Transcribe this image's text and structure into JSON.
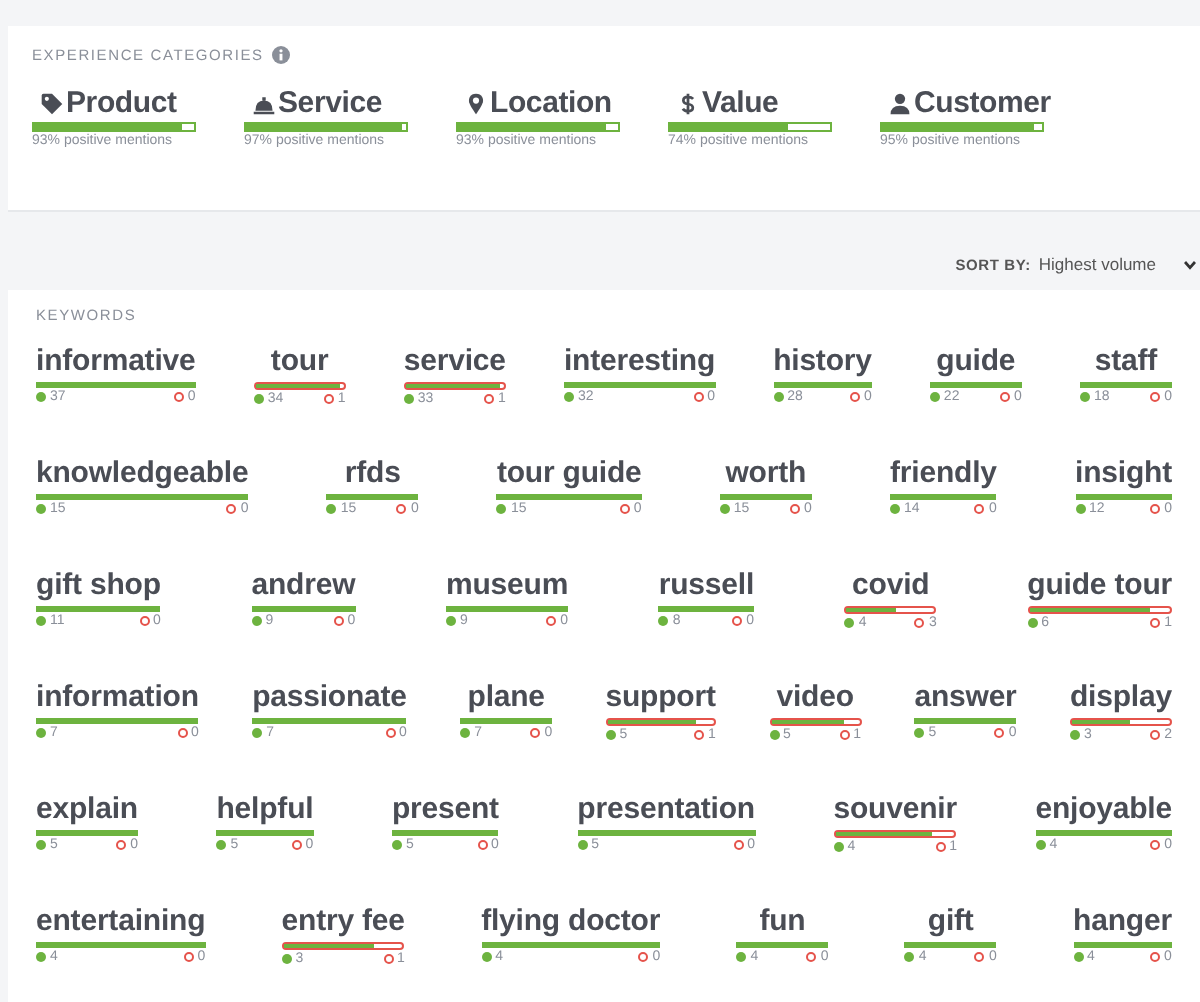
{
  "categories_panel": {
    "title": "EXPERIENCE CATEGORIES",
    "categories": [
      {
        "kind": "tag",
        "label": "Product",
        "level": 0.93,
        "caption": "93% positive mentions"
      },
      {
        "kind": "bell",
        "label": "Service",
        "level": 0.97,
        "caption": "97% positive mentions"
      },
      {
        "kind": "pin",
        "label": "Location",
        "level": 0.93,
        "caption": "93% positive mentions"
      },
      {
        "kind": "dollar",
        "label": "Value",
        "level": 0.74,
        "caption": "74% positive mentions"
      },
      {
        "kind": "person",
        "label": "Customer",
        "level": 0.95,
        "caption": "95% positive mentions"
      }
    ]
  },
  "sort": {
    "label": "SORT BY:",
    "value": "Highest volume"
  },
  "keywords": {
    "title": "KEYWORDS",
    "rows": [
      [
        {
          "word": "informative",
          "positive": "37",
          "negative": "0",
          "level": 1
        },
        {
          "word": "tour",
          "positive": "34",
          "negative": "1",
          "level": 0.97
        },
        {
          "word": "service",
          "positive": "33",
          "negative": "1",
          "level": 0.97
        },
        {
          "word": "interesting",
          "positive": "32",
          "negative": "0",
          "level": 1
        },
        {
          "word": "history",
          "positive": "28",
          "negative": "0",
          "level": 1
        },
        {
          "word": "guide",
          "positive": "22",
          "negative": "0",
          "level": 1
        },
        {
          "word": "staff",
          "positive": "18",
          "negative": "0",
          "level": 1
        }
      ],
      [
        {
          "word": "knowledgeable",
          "positive": "15",
          "negative": "0",
          "level": 1
        },
        {
          "word": "rfds",
          "positive": "15",
          "negative": "0",
          "level": 1
        },
        {
          "word": "tour guide",
          "positive": "15",
          "negative": "0",
          "level": 1
        },
        {
          "word": "worth",
          "positive": "15",
          "negative": "0",
          "level": 1
        },
        {
          "word": "friendly",
          "positive": "14",
          "negative": "0",
          "level": 1
        },
        {
          "word": "insight",
          "positive": "12",
          "negative": "0",
          "level": 1
        }
      ],
      [
        {
          "word": "gift shop",
          "positive": "11",
          "negative": "0",
          "level": 1
        },
        {
          "word": "andrew",
          "positive": "9",
          "negative": "0",
          "level": 1
        },
        {
          "word": "museum",
          "positive": "9",
          "negative": "0",
          "level": 1
        },
        {
          "word": "russell",
          "positive": "8",
          "negative": "0",
          "level": 1
        },
        {
          "word": "covid",
          "positive": "4",
          "negative": "3",
          "level": 0.57
        },
        {
          "word": "guide tour",
          "positive": "6",
          "negative": "1",
          "level": 0.86
        }
      ],
      [
        {
          "word": "information",
          "positive": "7",
          "negative": "0",
          "level": 1
        },
        {
          "word": "passionate",
          "positive": "7",
          "negative": "0",
          "level": 1
        },
        {
          "word": "plane",
          "positive": "7",
          "negative": "0",
          "level": 1
        },
        {
          "word": "support",
          "positive": "5",
          "negative": "1",
          "level": 0.83
        },
        {
          "word": "video",
          "positive": "5",
          "negative": "1",
          "level": 0.83
        },
        {
          "word": "answer",
          "positive": "5",
          "negative": "0",
          "level": 1
        },
        {
          "word": "display",
          "positive": "3",
          "negative": "2",
          "level": 0.6
        }
      ],
      [
        {
          "word": "explain",
          "positive": "5",
          "negative": "0",
          "level": 1
        },
        {
          "word": "helpful",
          "positive": "5",
          "negative": "0",
          "level": 1
        },
        {
          "word": "present",
          "positive": "5",
          "negative": "0",
          "level": 1
        },
        {
          "word": "presentation",
          "positive": "5",
          "negative": "0",
          "level": 1
        },
        {
          "word": "souvenir",
          "positive": "4",
          "negative": "1",
          "level": 0.8
        },
        {
          "word": "enjoyable",
          "positive": "4",
          "negative": "0",
          "level": 1
        }
      ],
      [
        {
          "word": "entertaining",
          "positive": "4",
          "negative": "0",
          "level": 1
        },
        {
          "word": "entry fee",
          "positive": "3",
          "negative": "1",
          "level": 0.75
        },
        {
          "word": "flying doctor",
          "positive": "4",
          "negative": "0",
          "level": 1
        },
        {
          "word": "fun",
          "positive": "4",
          "negative": "0",
          "level": 1
        },
        {
          "word": "gift",
          "positive": "4",
          "negative": "0",
          "level": 1
        },
        {
          "word": "hanger",
          "positive": "4",
          "negative": "0",
          "level": 1
        }
      ]
    ]
  }
}
